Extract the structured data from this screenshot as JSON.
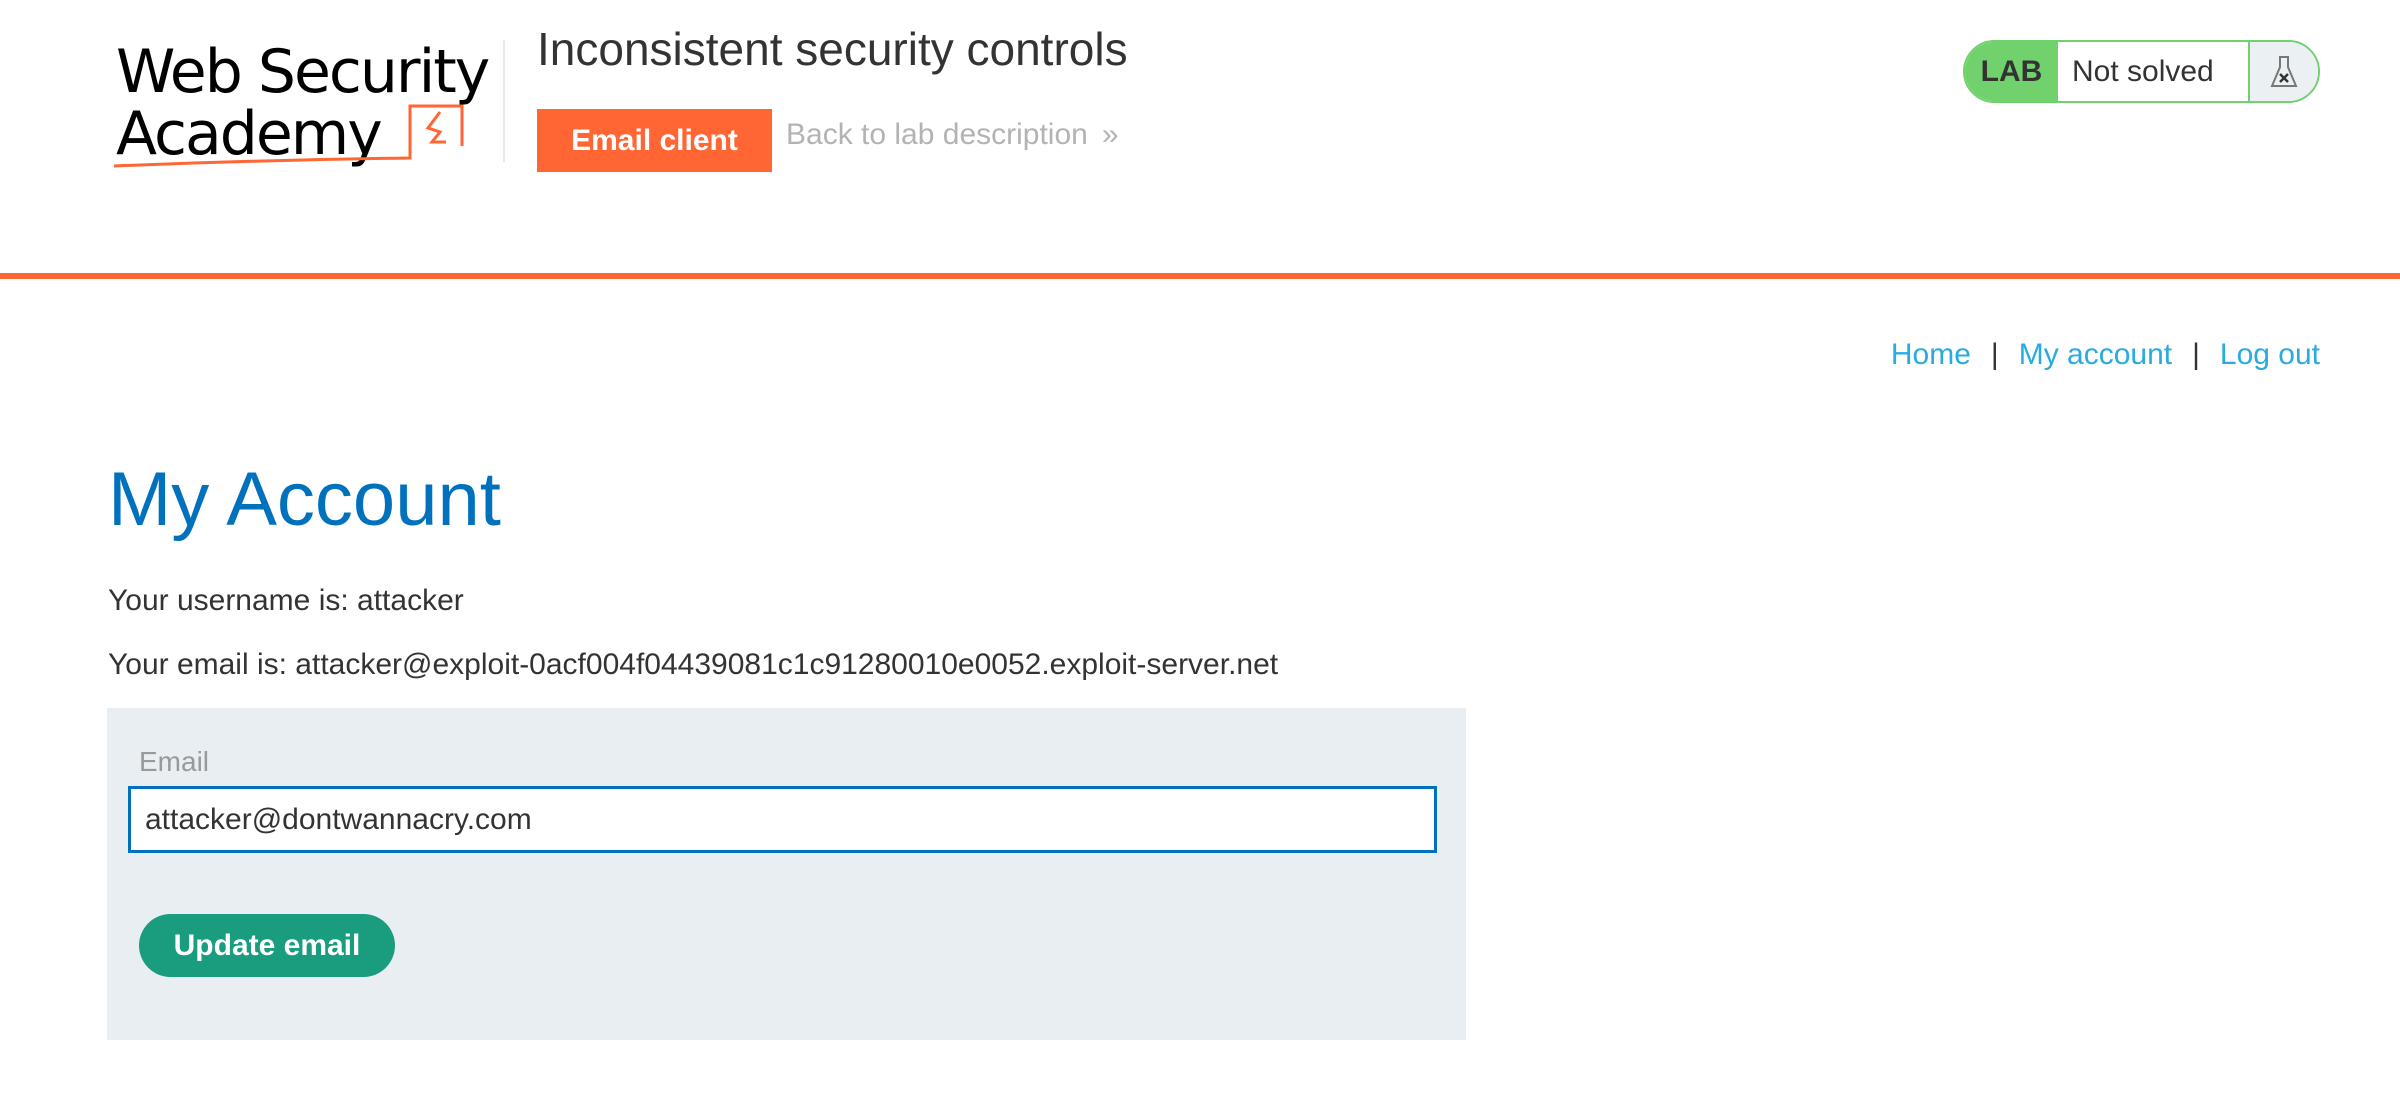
{
  "header": {
    "logo_alt": "Web Security Academy",
    "logo_line1": "Web Security",
    "logo_line2": "Academy",
    "lab_title": "Inconsistent security controls",
    "email_client_label": "Email client",
    "back_link_label": "Back to lab description",
    "back_link_icon": "double-chevron-right",
    "back_link_glyph": "»"
  },
  "lab_status": {
    "tag": "LAB",
    "status": "Not solved",
    "icon": "flask-x-icon"
  },
  "colors": {
    "brand_orange": "#ff6633",
    "title_blue": "#0071bc",
    "link_blue": "#29abe0",
    "badge_green": "#70d16d",
    "button_green": "#1a9c7f",
    "panel_bg": "#e8eef2"
  },
  "nav": {
    "items": [
      {
        "label": "Home"
      },
      {
        "label": "My account"
      },
      {
        "label": "Log out"
      }
    ],
    "separator": "|"
  },
  "main": {
    "title": "My Account",
    "username_line": "Your username is: attacker",
    "email_line": "Your email is: attacker@exploit-0acf004f04439081c1c91280010e0052.exploit-server.net",
    "form": {
      "email_label": "Email",
      "email_value": "attacker@dontwannacry.com",
      "submit_label": "Update email"
    }
  }
}
